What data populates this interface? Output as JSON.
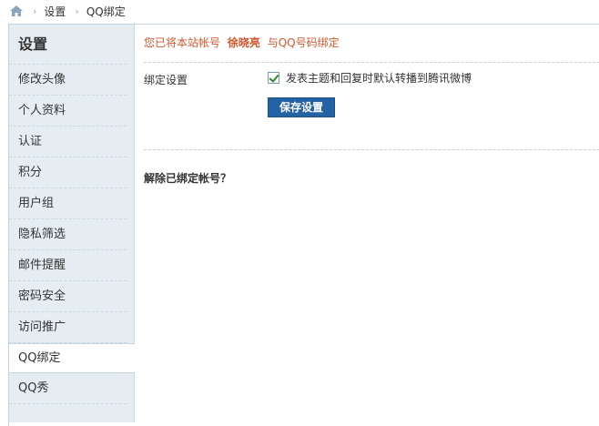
{
  "breadcrumb": {
    "home_icon": "home-icon",
    "items": [
      "设置",
      "QQ绑定"
    ],
    "separator": "›"
  },
  "sidebar": {
    "title": "设置",
    "items": [
      {
        "label": "修改头像",
        "active": false
      },
      {
        "label": "个人资料",
        "active": false
      },
      {
        "label": "认证",
        "active": false
      },
      {
        "label": "积分",
        "active": false
      },
      {
        "label": "用户组",
        "active": false
      },
      {
        "label": "隐私筛选",
        "active": false
      },
      {
        "label": "邮件提醒",
        "active": false
      },
      {
        "label": "密码安全",
        "active": false
      },
      {
        "label": "访问推广",
        "active": false
      },
      {
        "label": "QQ绑定",
        "active": true
      },
      {
        "label": "QQ秀",
        "active": false
      }
    ]
  },
  "main": {
    "notice_prefix": "您已将本站帐号",
    "notice_username": "徐晓亮",
    "notice_suffix": "与QQ号码绑定",
    "bind_settings_label": "绑定设置",
    "option_label": "发表主题和回复时默认转播到腾讯微博",
    "option_checked": true,
    "save_button": "保存设置",
    "unbind_title": "解除已绑定帐号？"
  },
  "colors": {
    "accent_orange": "#d3582f",
    "button_blue": "#2463a3",
    "sidebar_bg": "#e5edf2",
    "border": "#c2d5e3"
  }
}
